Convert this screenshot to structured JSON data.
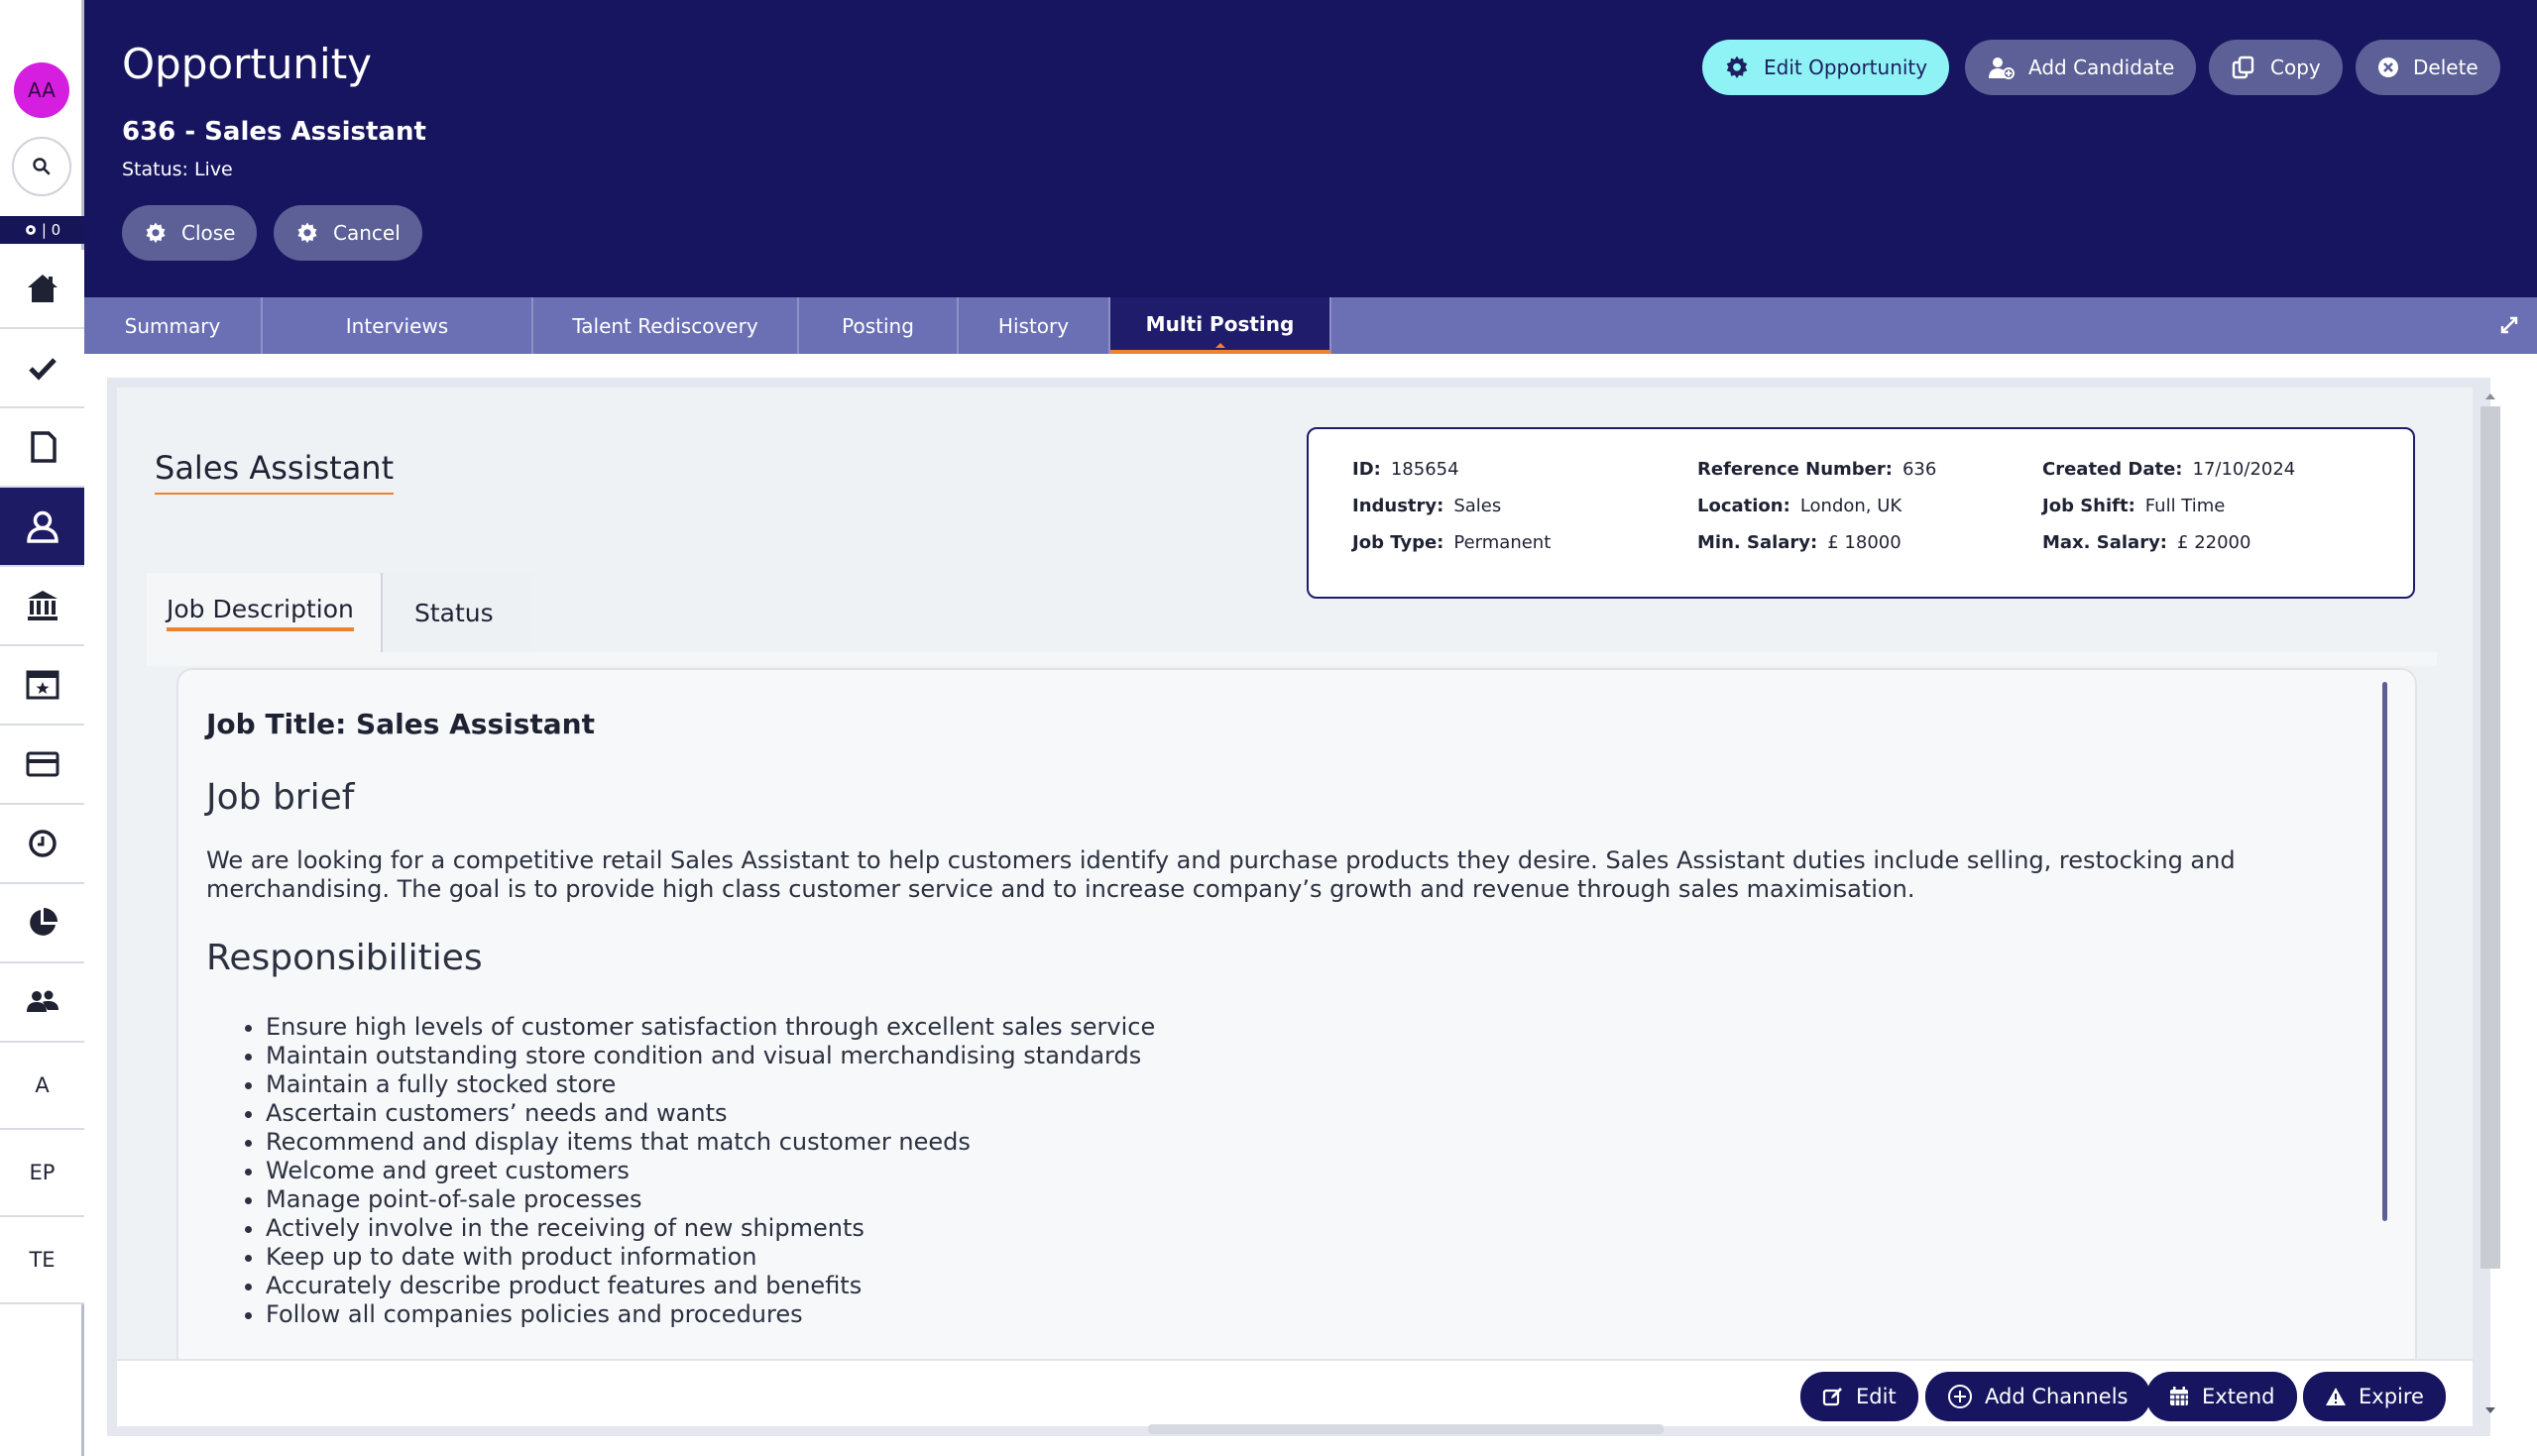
{
  "sidebar": {
    "avatar_initials": "AA",
    "status_label": "| 0",
    "items": [
      {
        "id": "home",
        "icon": "home-icon"
      },
      {
        "id": "tasks",
        "icon": "check-icon"
      },
      {
        "id": "documents",
        "icon": "document-icon"
      },
      {
        "id": "candidates",
        "icon": "person-icon"
      },
      {
        "id": "companies",
        "icon": "bank-icon"
      },
      {
        "id": "calendar",
        "icon": "calendar-icon"
      },
      {
        "id": "cards",
        "icon": "card-icon"
      },
      {
        "id": "timesheets",
        "icon": "clock-icon"
      },
      {
        "id": "reports",
        "icon": "pie-chart-icon"
      },
      {
        "id": "contacts",
        "icon": "people-icon"
      }
    ],
    "text_items": [
      "A",
      "EP",
      "TE"
    ]
  },
  "header": {
    "page_title": "Opportunity",
    "record_title": "636 - Sales Assistant",
    "status_label": "Status:",
    "status_value": "Live",
    "close_label": "Close",
    "cancel_label": "Cancel",
    "edit_label": "Edit Opportunity",
    "add_candidate_label": "Add Candidate",
    "copy_label": "Copy",
    "delete_label": "Delete"
  },
  "tabs": [
    "Summary",
    "Interviews",
    "Talent Rediscovery",
    "Posting",
    "History",
    "Multi Posting"
  ],
  "active_tab": "Multi Posting",
  "detail": {
    "title": "Sales Assistant",
    "info": {
      "id_label": "ID:",
      "id_value": "185654",
      "ref_label": "Reference Number:",
      "ref_value": "636",
      "created_label": "Created Date:",
      "created_value": "17/10/2024",
      "industry_label": "Industry:",
      "industry_value": "Sales",
      "location_label": "Location:",
      "location_value": "London, UK",
      "shift_label": "Job Shift:",
      "shift_value": "Full Time",
      "type_label": "Job Type:",
      "type_value": "Permanent",
      "min_label": "Min. Salary:",
      "min_value": "£ 18000",
      "max_label": "Max. Salary:",
      "max_value": "£ 22000"
    },
    "subtabs": [
      "Job Description",
      "Status"
    ],
    "description": {
      "job_title": "Job Title: Sales Assistant",
      "brief_heading": "Job brief",
      "brief_text": "We are looking for a competitive retail Sales Assistant to help customers identify and purchase products they desire. Sales Assistant duties include selling, restocking and merchandising. The goal is to provide high class customer service and to increase company’s growth and revenue through sales maximisation.",
      "resp_heading": "Responsibilities",
      "responsibilities": [
        "Ensure high levels of customer satisfaction through excellent sales service",
        "Maintain outstanding store condition and visual merchandising standards",
        "Maintain a fully stocked store",
        "Ascertain customers’ needs and wants",
        "Recommend and display items that match customer needs",
        "Welcome and greet customers",
        "Manage point-of-sale processes",
        "Actively involve in the receiving of new shipments",
        "Keep up to date with product information",
        "Accurately describe product features and benefits",
        "Follow all companies policies and procedures"
      ]
    },
    "actions": {
      "edit": "Edit",
      "add_channels": "Add Channels",
      "extend": "Extend",
      "expire": "Expire"
    }
  },
  "colors": {
    "header_bg": "#171560",
    "tabbar_bg": "#6b70b4",
    "accent_orange": "#f0812f",
    "primary_button": "#8ff3f5",
    "avatar": "#d61ee0"
  }
}
